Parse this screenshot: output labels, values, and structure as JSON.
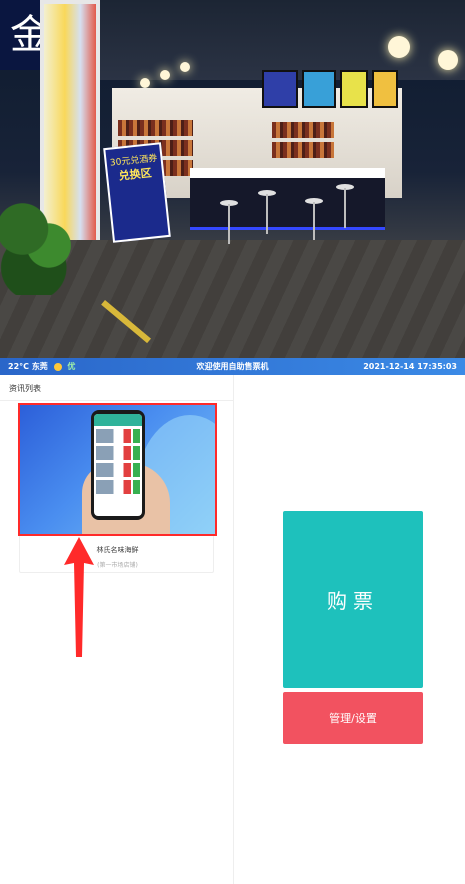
{
  "status_bar": {
    "temperature": "22°C",
    "city": "东莞",
    "weather_icon": "sun-icon",
    "air_quality": "优",
    "welcome_text": "欢迎使用自助售票机",
    "datetime": "2021-12-14 17:35:03"
  },
  "hero_image": {
    "sign_char": "金",
    "poster_lines": [
      "30元兑酒券",
      "兑换区"
    ]
  },
  "news": {
    "title": "资讯列表",
    "items": [
      {
        "caption": "林氏名味海鲜",
        "subtitle": "(第一市场店铺)"
      }
    ]
  },
  "actions": {
    "buy_label": "购票",
    "manage_label": "管理/设置"
  },
  "colors": {
    "status_bar": "#3b8ae6",
    "buy_button": "#1ec1bc",
    "manage_button": "#f25260",
    "highlight_border": "#ff2a2a"
  }
}
